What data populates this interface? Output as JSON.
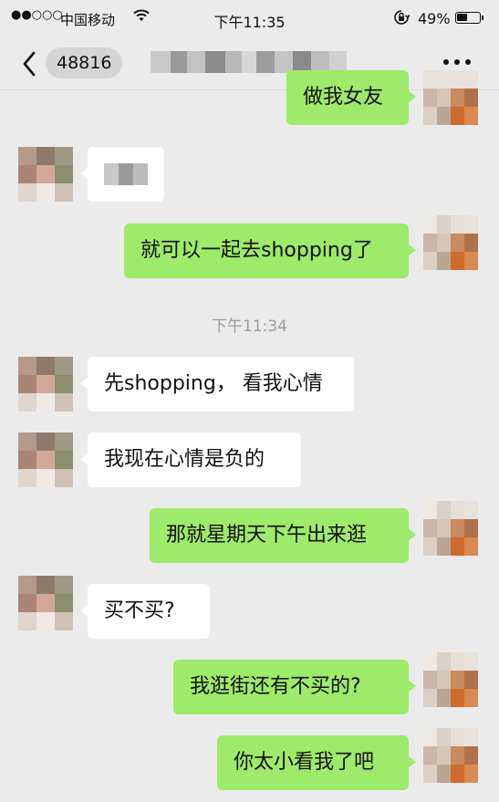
{
  "status_bar": {
    "signal": "●●○○○",
    "carrier": "中国移动",
    "time": "下午11:35",
    "battery_percent": "49%",
    "battery_level": 0.49
  },
  "nav": {
    "unread_count": "48816",
    "contact_name_blurred": true
  },
  "chat": {
    "timestamp": "下午11:34",
    "messages": [
      {
        "side": "out",
        "text": "做我女友"
      },
      {
        "side": "in",
        "text": "",
        "blurred": true
      },
      {
        "side": "out",
        "text": "就可以一起去shopping了"
      },
      {
        "side": "in",
        "text": "先shopping， 看我心情"
      },
      {
        "side": "in",
        "text": "我现在心情是负的"
      },
      {
        "side": "out",
        "text": "那就星期天下午出来逛"
      },
      {
        "side": "in",
        "text": "买不买?"
      },
      {
        "side": "out",
        "text": "我逛街还有不买的?"
      },
      {
        "side": "out",
        "text": "你太小看我了吧"
      }
    ]
  },
  "colors": {
    "background": "#ebebeb",
    "outgoing_bubble": "#9eea6a",
    "incoming_bubble": "#ffffff",
    "timestamp_text": "#9c9c9c"
  }
}
